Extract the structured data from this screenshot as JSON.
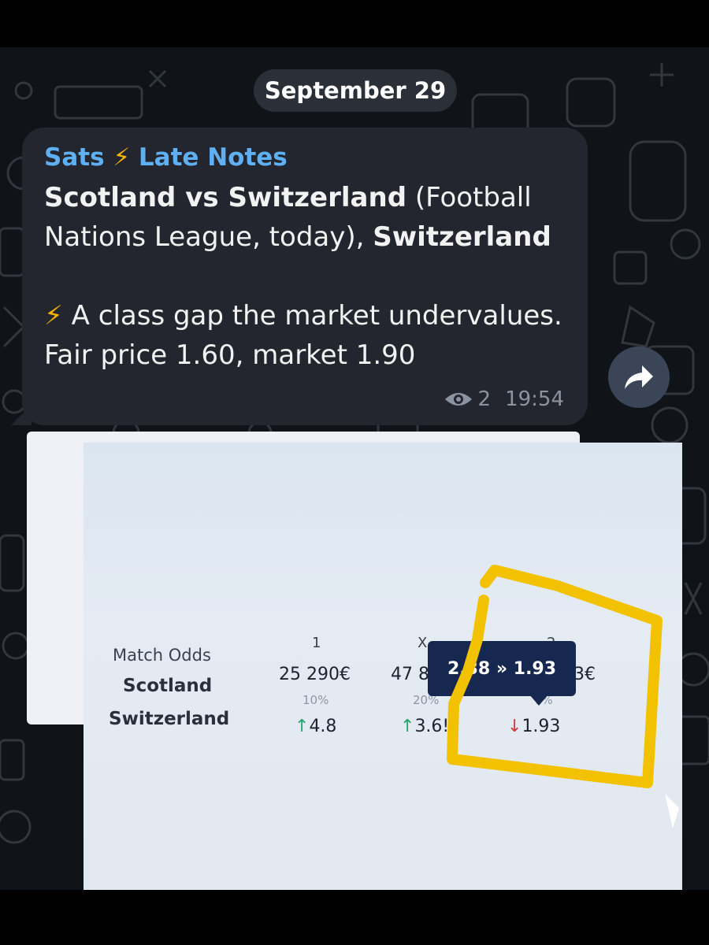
{
  "date_separator": "September 29",
  "message": {
    "sender_prefix": "Sats",
    "sender_bolt": "⚡",
    "sender_suffix": "Late Notes",
    "match_bold": "Scotland vs Switzerland",
    "match_rest": " (Football Nations League, today), ",
    "pick": "Switzerland",
    "bolt": "⚡",
    "body": " A class gap the market undervalues. Fair price 1.60, market 1.90",
    "views": "2",
    "time": "19:54"
  },
  "odds_photo": {
    "title": "Match Odds",
    "team_home": "Scotland",
    "team_away": "Switzerland",
    "columns": [
      {
        "header": "1",
        "volume": "25 290€",
        "percent": "10%",
        "arrow": "↑",
        "odds": "4.8"
      },
      {
        "header": "X",
        "volume": "47 87",
        "percent": "20%",
        "arrow": "↑",
        "odds": "3.6!"
      },
      {
        "header": "2",
        "volume": "3€",
        "percent": "7%",
        "arrow": "↓",
        "odds": "1.93"
      }
    ],
    "tooltip": "2.38 » 1.93",
    "colors": {
      "up": "#21a86a",
      "down": "#d23a3a",
      "highlight": "#f2c200"
    }
  },
  "icons": {
    "views": "eye-icon",
    "share": "share-arrow-icon"
  }
}
